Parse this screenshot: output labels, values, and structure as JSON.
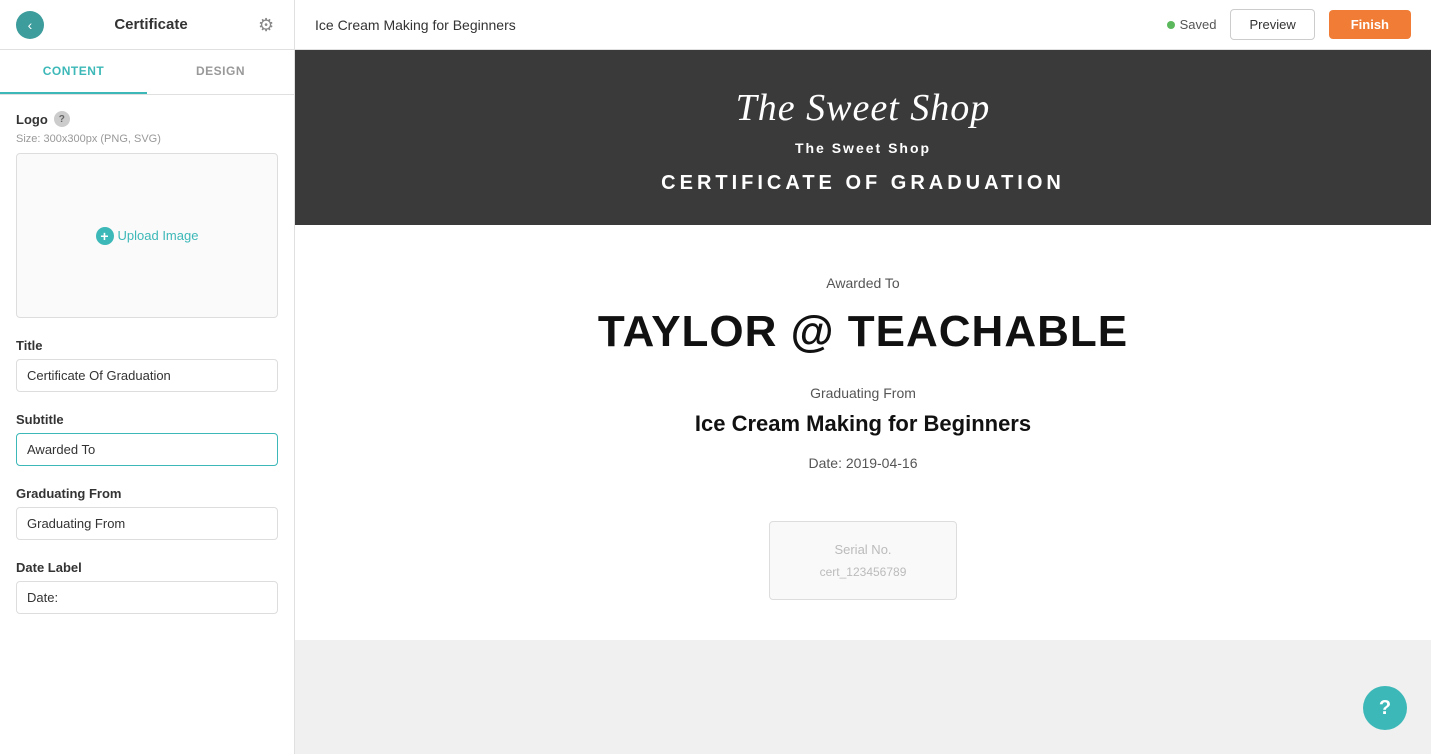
{
  "app": {
    "panel_title": "Certificate",
    "course_title": "Ice Cream Making for Beginners",
    "saved_text": "Saved",
    "preview_label": "Preview",
    "finish_label": "Finish"
  },
  "tabs": {
    "content_label": "CONTENT",
    "design_label": "DESIGN"
  },
  "logo_section": {
    "label": "Logo",
    "size_hint": "Size: 300x300px (PNG, SVG)",
    "upload_label": "Upload Image"
  },
  "title_section": {
    "label": "Title",
    "value": "Certificate Of Graduation"
  },
  "subtitle_section": {
    "label": "Subtitle",
    "value": "Awarded To"
  },
  "graduating_from_section": {
    "label": "Graduating From",
    "value": "Graduating From"
  },
  "date_label_section": {
    "label": "Date Label",
    "value": "Date:"
  },
  "certificate_preview": {
    "logo_script": "The Sweet Shop",
    "school_name": "The Sweet Shop",
    "cert_title": "CERTIFICATE OF GRADUATION",
    "awarded_to_label": "Awarded To",
    "student_name": "TAYLOR @ TEACHABLE",
    "graduating_from_label": "Graduating From",
    "course_name": "Ice Cream Making for Beginners",
    "date": "Date: 2019-04-16",
    "serial_label": "Serial No.",
    "serial_value": "cert_123456789"
  }
}
